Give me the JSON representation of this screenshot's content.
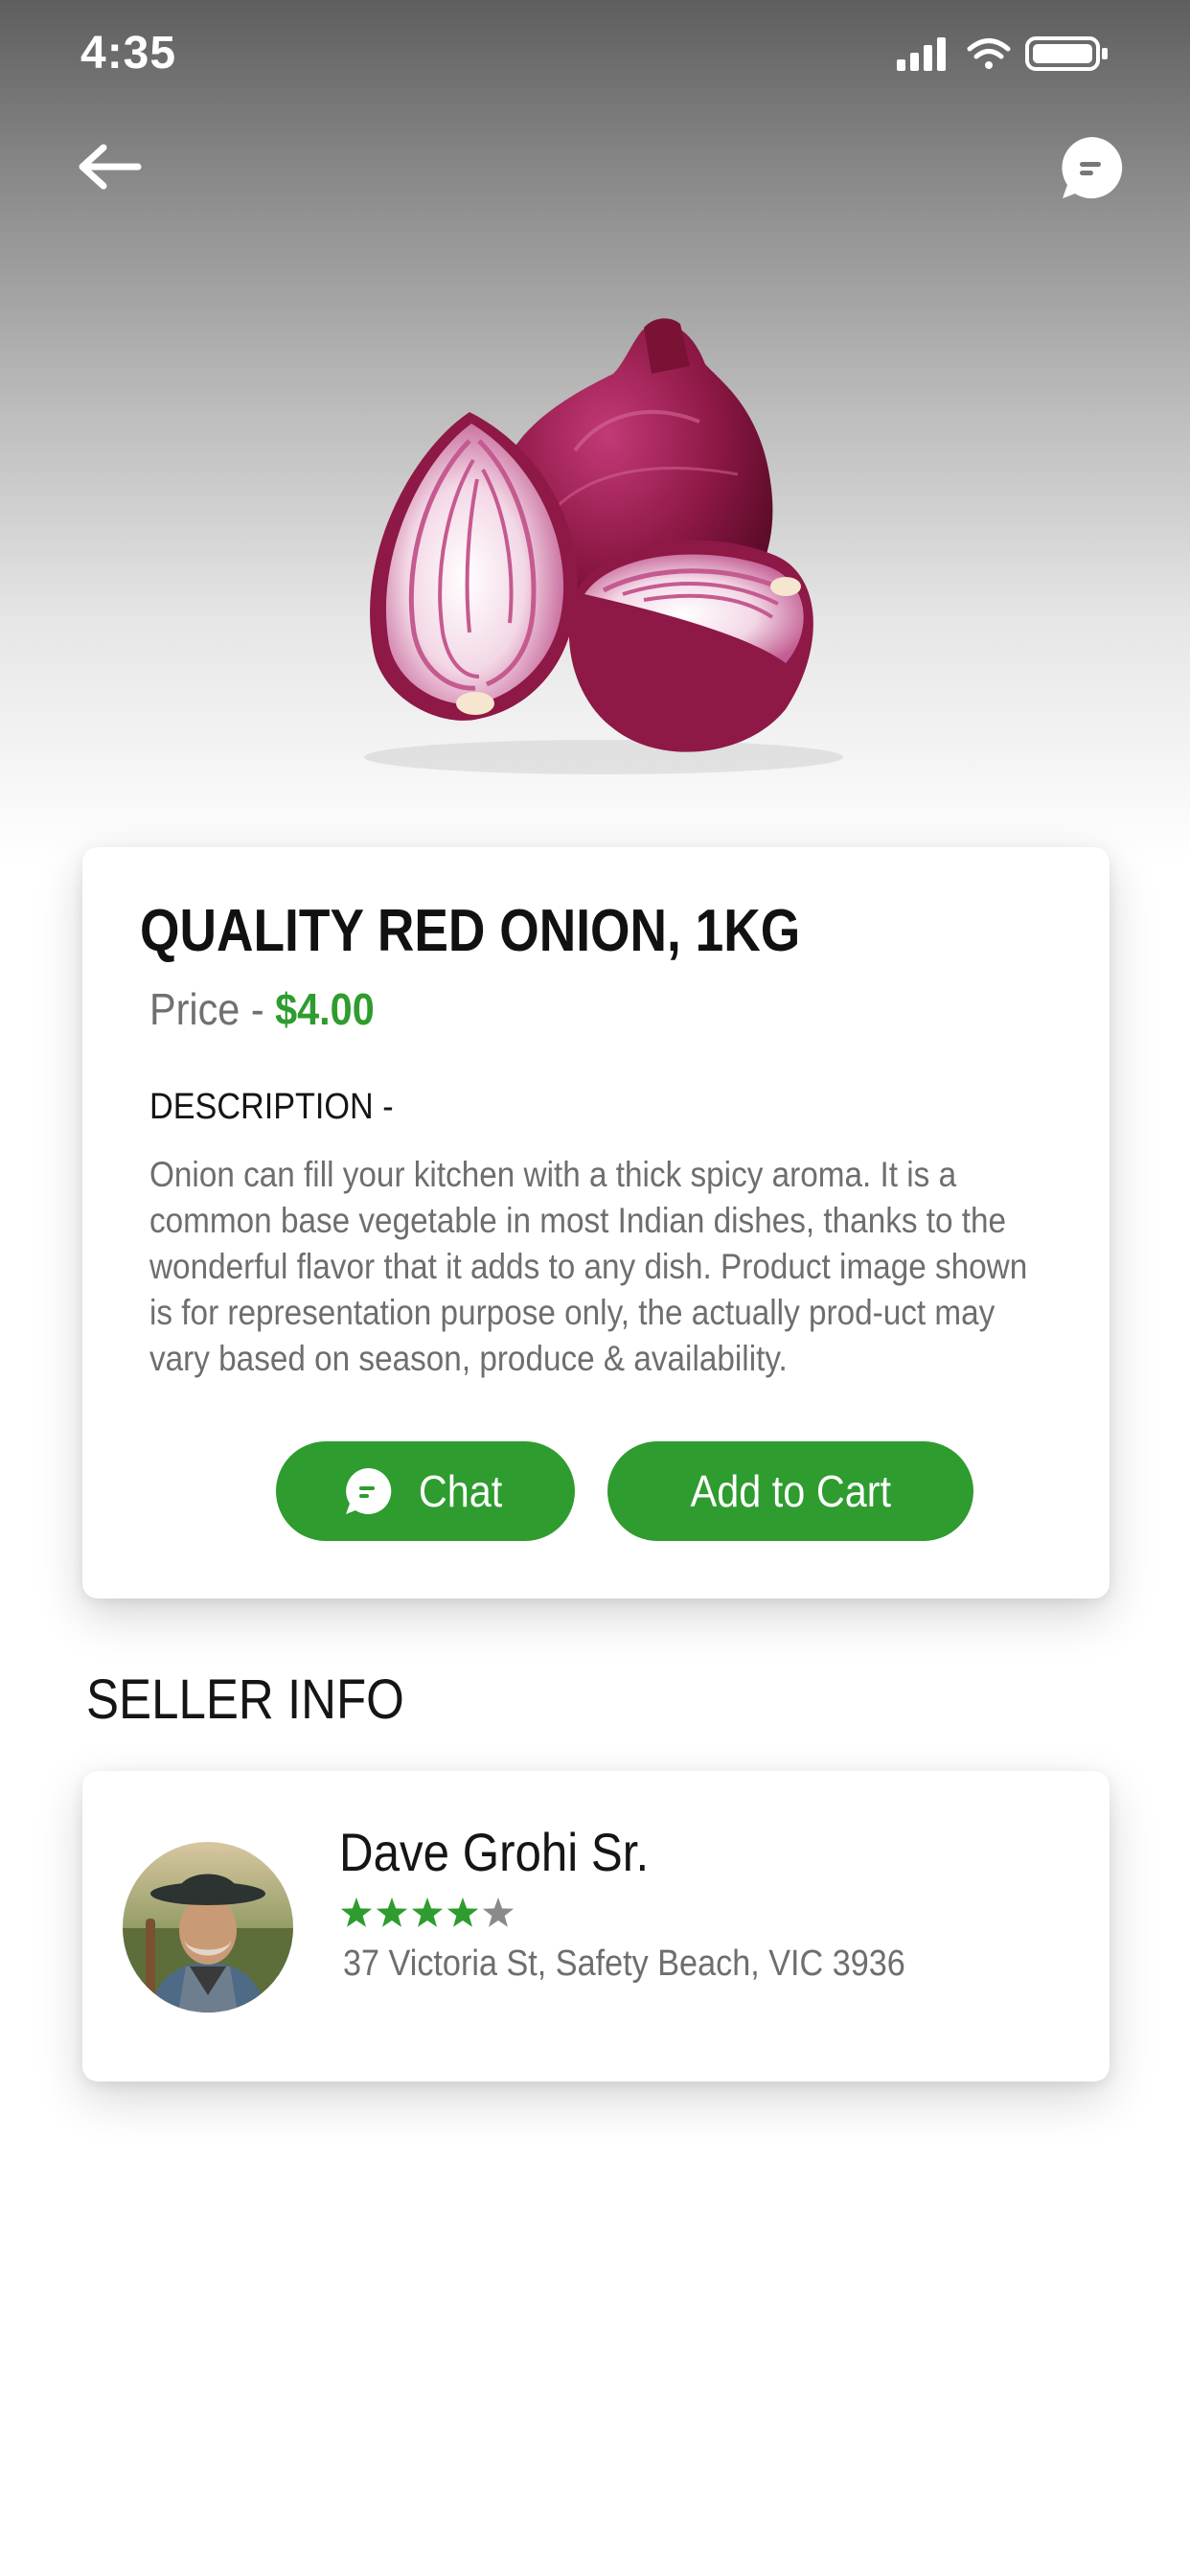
{
  "status_bar": {
    "time": "4:35",
    "icons": [
      "cellular-signal-icon",
      "wifi-icon",
      "battery-icon"
    ]
  },
  "header": {
    "back_icon": "arrow-left-icon",
    "chat_icon": "chat-bubble-icon"
  },
  "product": {
    "image": "red-onion-photo",
    "title": "QUALITY RED ONION, 1KG",
    "price_label": "Price - ",
    "price_value": "$4.00",
    "description_heading": "DESCRIPTION -",
    "description": "Onion can fill your kitchen with a thick spicy aroma. It is a common base vegetable in most Indian dishes, thanks to the wonderful flavor that it adds to any dish. Product image shown is for representation purpose only, the actually prod-uct may vary based on season, produce & availability.",
    "chat_button_label": "Chat",
    "cart_button_label": "Add to Cart"
  },
  "seller": {
    "section_title": "SELLER INFO",
    "name": "Dave Grohi Sr.",
    "rating": 4,
    "rating_max": 5,
    "address": "37 Victoria St, Safety Beach, VIC 3936",
    "avatar": "seller-avatar-photo"
  },
  "colors": {
    "accent": "#2e9c2e",
    "text_dark": "#151515",
    "text_muted": "#6e6e6e",
    "star_off": "#8a8a8a"
  }
}
